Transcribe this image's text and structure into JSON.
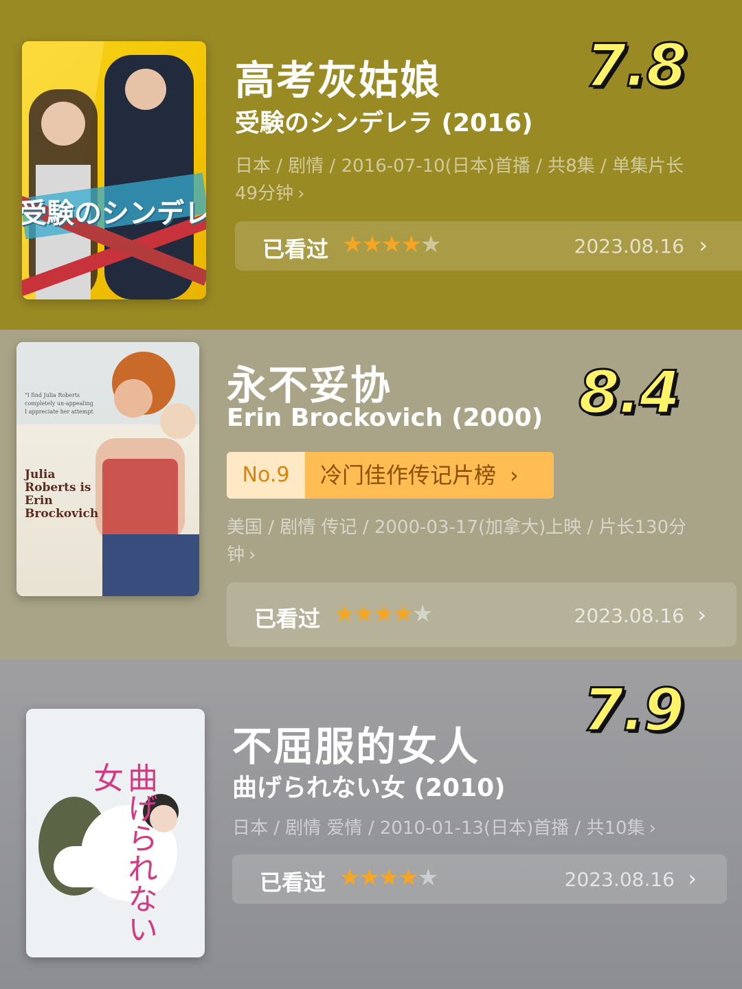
{
  "items": [
    {
      "title": "高考灰姑娘",
      "subtitle": "受験のシンデレラ (2016)",
      "meta_line1": "日本 / 剧情 / 2016-07-10(日本)首播 / 共8集 / 单集片长",
      "meta_line2": "49分钟",
      "score": "7.8",
      "watched_label": "已看过",
      "rating_stars": 4,
      "rating_max": 5,
      "date": "2023.08.16",
      "poster_text": "受験のシンデレ"
    },
    {
      "title": "永不妥协",
      "subtitle": "Erin Brockovich (2000)",
      "rank_no": "No.9",
      "rank_list": "冷门佳作传记片榜",
      "meta_line1": "美国 / 剧情 传记 / 2000-03-17(加拿大)上映 / 片长130分",
      "meta_line2": "钟",
      "score": "8.4",
      "watched_label": "已看过",
      "rating_stars": 4,
      "rating_max": 5,
      "date": "2023.08.16",
      "poster_text": "Julia Roberts is Erin Brockovich"
    },
    {
      "title": "不屈服的女人",
      "subtitle": "曲げられない女 (2010)",
      "meta_line1": "日本 / 剧情 爱情 / 2010-01-13(日本)首播 / 共10集",
      "score": "7.9",
      "watched_label": "已看过",
      "rating_stars": 4,
      "rating_max": 5,
      "date": "2023.08.16",
      "poster_text": "曲げられない女"
    }
  ],
  "icons": {
    "chevron": "chevron-right-icon",
    "star": "star-icon"
  },
  "colors": {
    "star_on": "#f5a623",
    "rank_bg": "#ffbd54",
    "score": "#fff36a"
  }
}
